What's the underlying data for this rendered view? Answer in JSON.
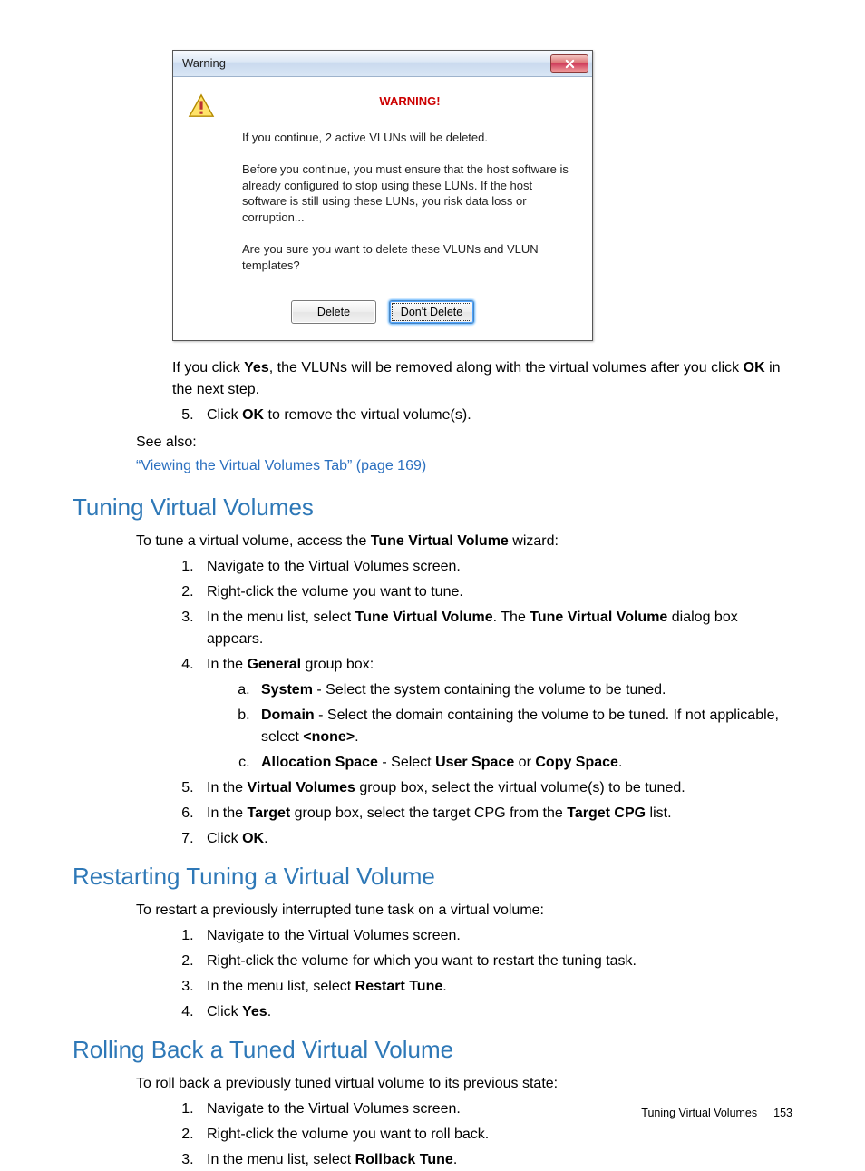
{
  "dialog": {
    "title": "Warning",
    "heading": "WARNING!",
    "para1": "If you continue, 2 active VLUNs will be deleted.",
    "para2": "Before you continue, you must ensure that the host software is already configured to stop using these LUNs. If the host software is still using these LUNs, you risk data loss or corruption...",
    "para3": "Are you sure you want to delete these VLUNs and VLUN templates?",
    "delete_btn": "Delete",
    "dont_delete_btn": "Don't Delete"
  },
  "after_dialog": {
    "if_yes_pre": "If you click ",
    "if_yes_bold1": "Yes",
    "if_yes_mid": ", the VLUNs will be removed along with the virtual volumes after you click ",
    "if_yes_bold2": "OK",
    "if_yes_post": " in the next step.",
    "step5_pre": "Click ",
    "step5_b": "OK",
    "step5_post": " to remove the virtual volume(s).",
    "see_also": "See also:",
    "link": "“Viewing the Virtual Volumes Tab” (page 169)"
  },
  "tuning": {
    "heading": "Tuning Virtual Volumes",
    "intro_pre": "To tune a virtual volume, access the ",
    "intro_b": "Tune Virtual Volume",
    "intro_post": " wizard:",
    "s1": "Navigate to the Virtual Volumes screen.",
    "s2": "Right-click the volume you want to tune.",
    "s3_pre": "In the menu list, select ",
    "s3_b1": "Tune Virtual Volume",
    "s3_mid": ". The ",
    "s3_b2": "Tune Virtual Volume",
    "s3_post": " dialog box appears.",
    "s4_pre": "In the ",
    "s4_b": "General",
    "s4_post": " group box:",
    "s4a_b": "System",
    "s4a_txt": " - Select the system containing the volume to be tuned.",
    "s4b_b": "Domain",
    "s4b_txt": " - Select the domain containing the volume to be tuned. If not applicable, select ",
    "s4b_b2": "<none>",
    "s4b_post": ".",
    "s4c_b": "Allocation Space",
    "s4c_mid": " - Select ",
    "s4c_b2": "User Space",
    "s4c_or": " or ",
    "s4c_b3": "Copy Space",
    "s4c_post": ".",
    "s5_pre": "In the ",
    "s5_b": "Virtual Volumes",
    "s5_post": " group box, select the virtual volume(s) to be tuned.",
    "s6_pre": "In the ",
    "s6_b1": "Target",
    "s6_mid": " group box, select the target CPG from the ",
    "s6_b2": "Target CPG",
    "s6_post": " list.",
    "s7_pre": "Click ",
    "s7_b": "OK",
    "s7_post": "."
  },
  "restart": {
    "heading": "Restarting Tuning a Virtual Volume",
    "intro": "To restart a previously interrupted tune task on a virtual volume:",
    "s1": "Navigate to the Virtual Volumes screen.",
    "s2": "Right-click the volume for which you want to restart the tuning task.",
    "s3_pre": "In the menu list, select ",
    "s3_b": "Restart Tune",
    "s3_post": ".",
    "s4_pre": "Click ",
    "s4_b": "Yes",
    "s4_post": "."
  },
  "rollback": {
    "heading": "Rolling Back a Tuned Virtual Volume",
    "intro": "To roll back a previously tuned virtual volume to its previous state:",
    "s1": "Navigate to the Virtual Volumes screen.",
    "s2": "Right-click the volume you want to roll back.",
    "s3_pre": "In the menu list, select ",
    "s3_b": "Rollback Tune",
    "s3_post": "."
  },
  "footer": {
    "section": "Tuning Virtual Volumes",
    "page": "153"
  }
}
